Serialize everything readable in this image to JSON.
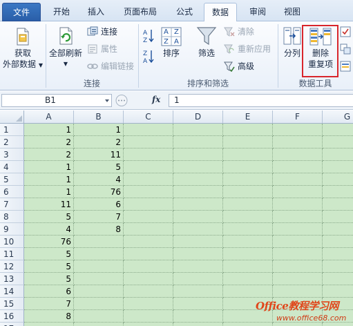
{
  "tabs": [
    {
      "label": "文件"
    },
    {
      "label": "开始"
    },
    {
      "label": "插入"
    },
    {
      "label": "页面布局"
    },
    {
      "label": "公式"
    },
    {
      "label": "数据"
    },
    {
      "label": "审阅"
    },
    {
      "label": "视图"
    }
  ],
  "ribbon": {
    "get_external_data": {
      "line1": "获取",
      "line2": "外部数据"
    },
    "refresh_all": "全部刷新",
    "connections": "连接",
    "properties": "属性",
    "edit_links": "编辑链接",
    "group_connections": "连接",
    "sort": "排序",
    "filter": "筛选",
    "clear": "清除",
    "reapply": "重新应用",
    "advanced": "高级",
    "group_sort_filter": "排序和筛选",
    "text_to_columns": "分列",
    "remove_duplicates": {
      "line1": "删除",
      "line2": "重复项"
    },
    "group_data_tools": "数据工具",
    "sort_az": {
      "a": "A",
      "z": "Z"
    }
  },
  "formula_bar": {
    "name_box": "B1",
    "fx": "fx",
    "value": "1"
  },
  "columns": [
    "A",
    "B",
    "C",
    "D",
    "E",
    "F",
    "G"
  ],
  "rows": [
    {
      "n": "1",
      "a": "1",
      "b": "1"
    },
    {
      "n": "2",
      "a": "2",
      "b": "2"
    },
    {
      "n": "3",
      "a": "2",
      "b": "11"
    },
    {
      "n": "4",
      "a": "1",
      "b": "5"
    },
    {
      "n": "5",
      "a": "1",
      "b": "4"
    },
    {
      "n": "6",
      "a": "1",
      "b": "76"
    },
    {
      "n": "7",
      "a": "11",
      "b": "6"
    },
    {
      "n": "8",
      "a": "5",
      "b": "7"
    },
    {
      "n": "9",
      "a": "4",
      "b": "8"
    },
    {
      "n": "10",
      "a": "76",
      "b": ""
    },
    {
      "n": "11",
      "a": "5",
      "b": ""
    },
    {
      "n": "12",
      "a": "5",
      "b": ""
    },
    {
      "n": "13",
      "a": "5",
      "b": ""
    },
    {
      "n": "14",
      "a": "6",
      "b": ""
    },
    {
      "n": "15",
      "a": "7",
      "b": ""
    },
    {
      "n": "16",
      "a": "8",
      "b": ""
    },
    {
      "n": "17",
      "a": "",
      "b": ""
    }
  ],
  "watermark": {
    "title": "Office教程学习网",
    "url": "www.office68.com"
  },
  "colors": {
    "grid_fill": "#cde8c9",
    "highlight": "#d8252b",
    "file_tab": "#2a5ea8"
  }
}
